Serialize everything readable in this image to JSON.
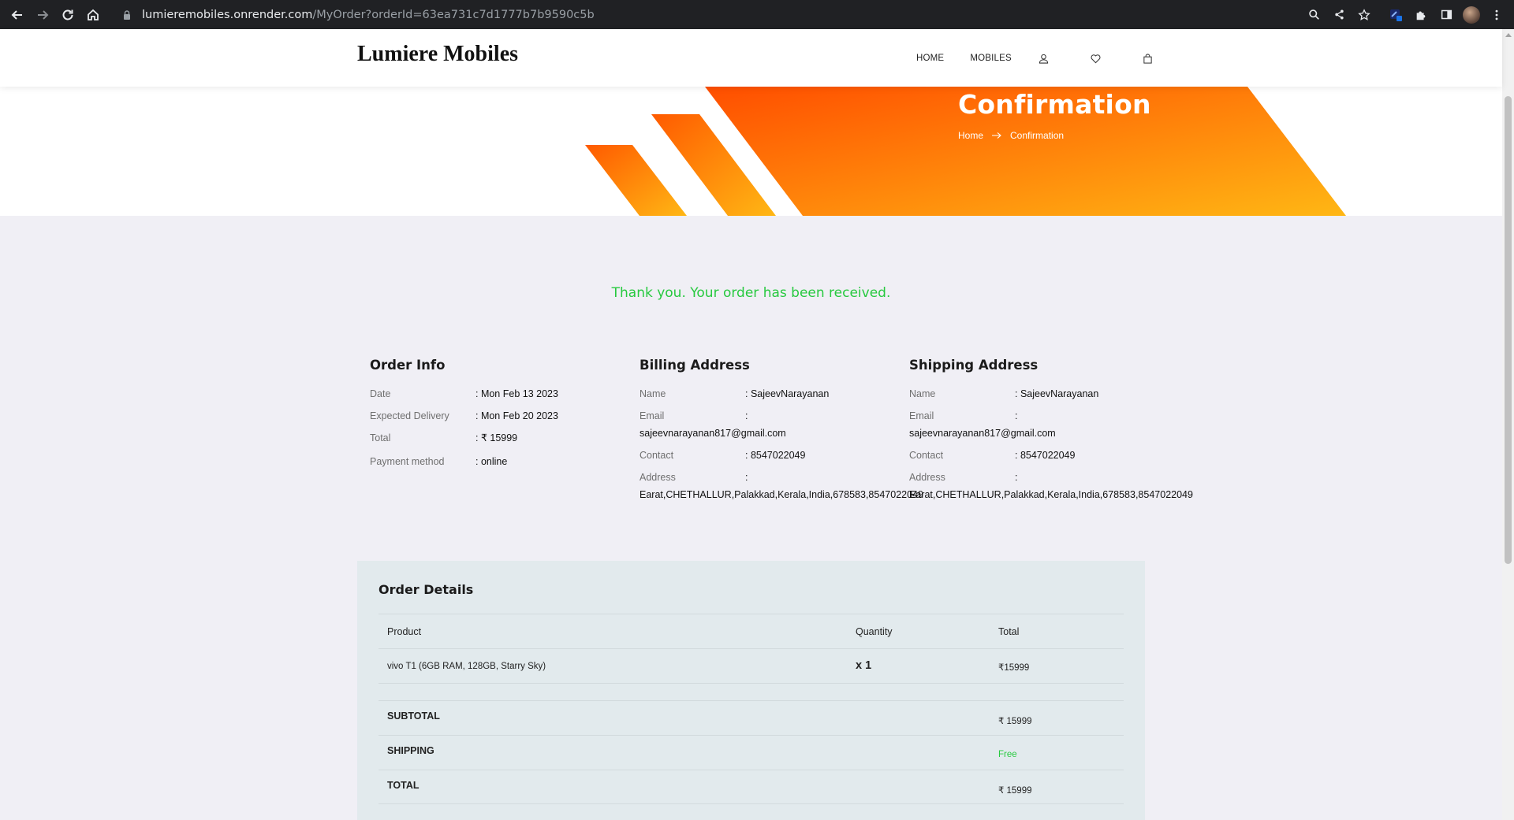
{
  "browser": {
    "url_host": "lumieremobiles.onrender.com",
    "url_path": "/MyOrder?orderId=63ea731c7d1777b7b9590c5b"
  },
  "header": {
    "logo": "Lumiere Mobiles",
    "menu": {
      "home": "HOME",
      "mobiles": "MOBILES"
    }
  },
  "hero": {
    "title": "Confirmation",
    "breadcrumb": {
      "home": "Home",
      "current": "Confirmation"
    },
    "colors": {
      "orange_dark": "#ff4e00",
      "orange_light": "#ffb714"
    }
  },
  "thanks_message": "Thank you. Your order has been received.",
  "order_info": {
    "title": "Order Info",
    "rows": [
      {
        "label": "Date",
        "value": ": Mon Feb 13 2023"
      },
      {
        "label": "Expected Delivery",
        "value": ": Mon Feb 20 2023"
      },
      {
        "label": "Total",
        "value": ": ₹ 15999"
      },
      {
        "label": "Payment method",
        "value": ": online"
      }
    ]
  },
  "billing": {
    "title": "Billing Address",
    "name_label": "Name",
    "name_value": ": SajeevNarayanan",
    "email_label": "Email",
    "email_colon": ":",
    "email_value": "sajeevnarayanan817@gmail.com",
    "contact_label": "Contact",
    "contact_value": ": 8547022049",
    "address_label": "Address",
    "address_colon": ":",
    "address_value": "Earat,CHETHALLUR,Palakkad,Kerala,India,678583,8547022049"
  },
  "shipping": {
    "title": "Shipping Address",
    "name_label": "Name",
    "name_value": ": SajeevNarayanan",
    "email_label": "Email",
    "email_colon": ":",
    "email_value": "sajeevnarayanan817@gmail.com",
    "contact_label": "Contact",
    "contact_value": ": 8547022049",
    "address_label": "Address",
    "address_colon": ":",
    "address_value": "Earat,CHETHALLUR,Palakkad,Kerala,India,678583,8547022049"
  },
  "order_details": {
    "title": "Order Details",
    "headers": {
      "product": "Product",
      "quantity": "Quantity",
      "total": "Total"
    },
    "items": [
      {
        "product": "vivo T1 (6GB RAM, 128GB, Starry Sky)",
        "quantity": "x 1",
        "total": "₹15999"
      }
    ],
    "summary": {
      "subtotal_label": "SUBTOTAL",
      "subtotal_value": "₹ 15999",
      "shipping_label": "SHIPPING",
      "shipping_value": "Free",
      "total_label": "TOTAL",
      "total_value": "₹ 15999"
    }
  }
}
